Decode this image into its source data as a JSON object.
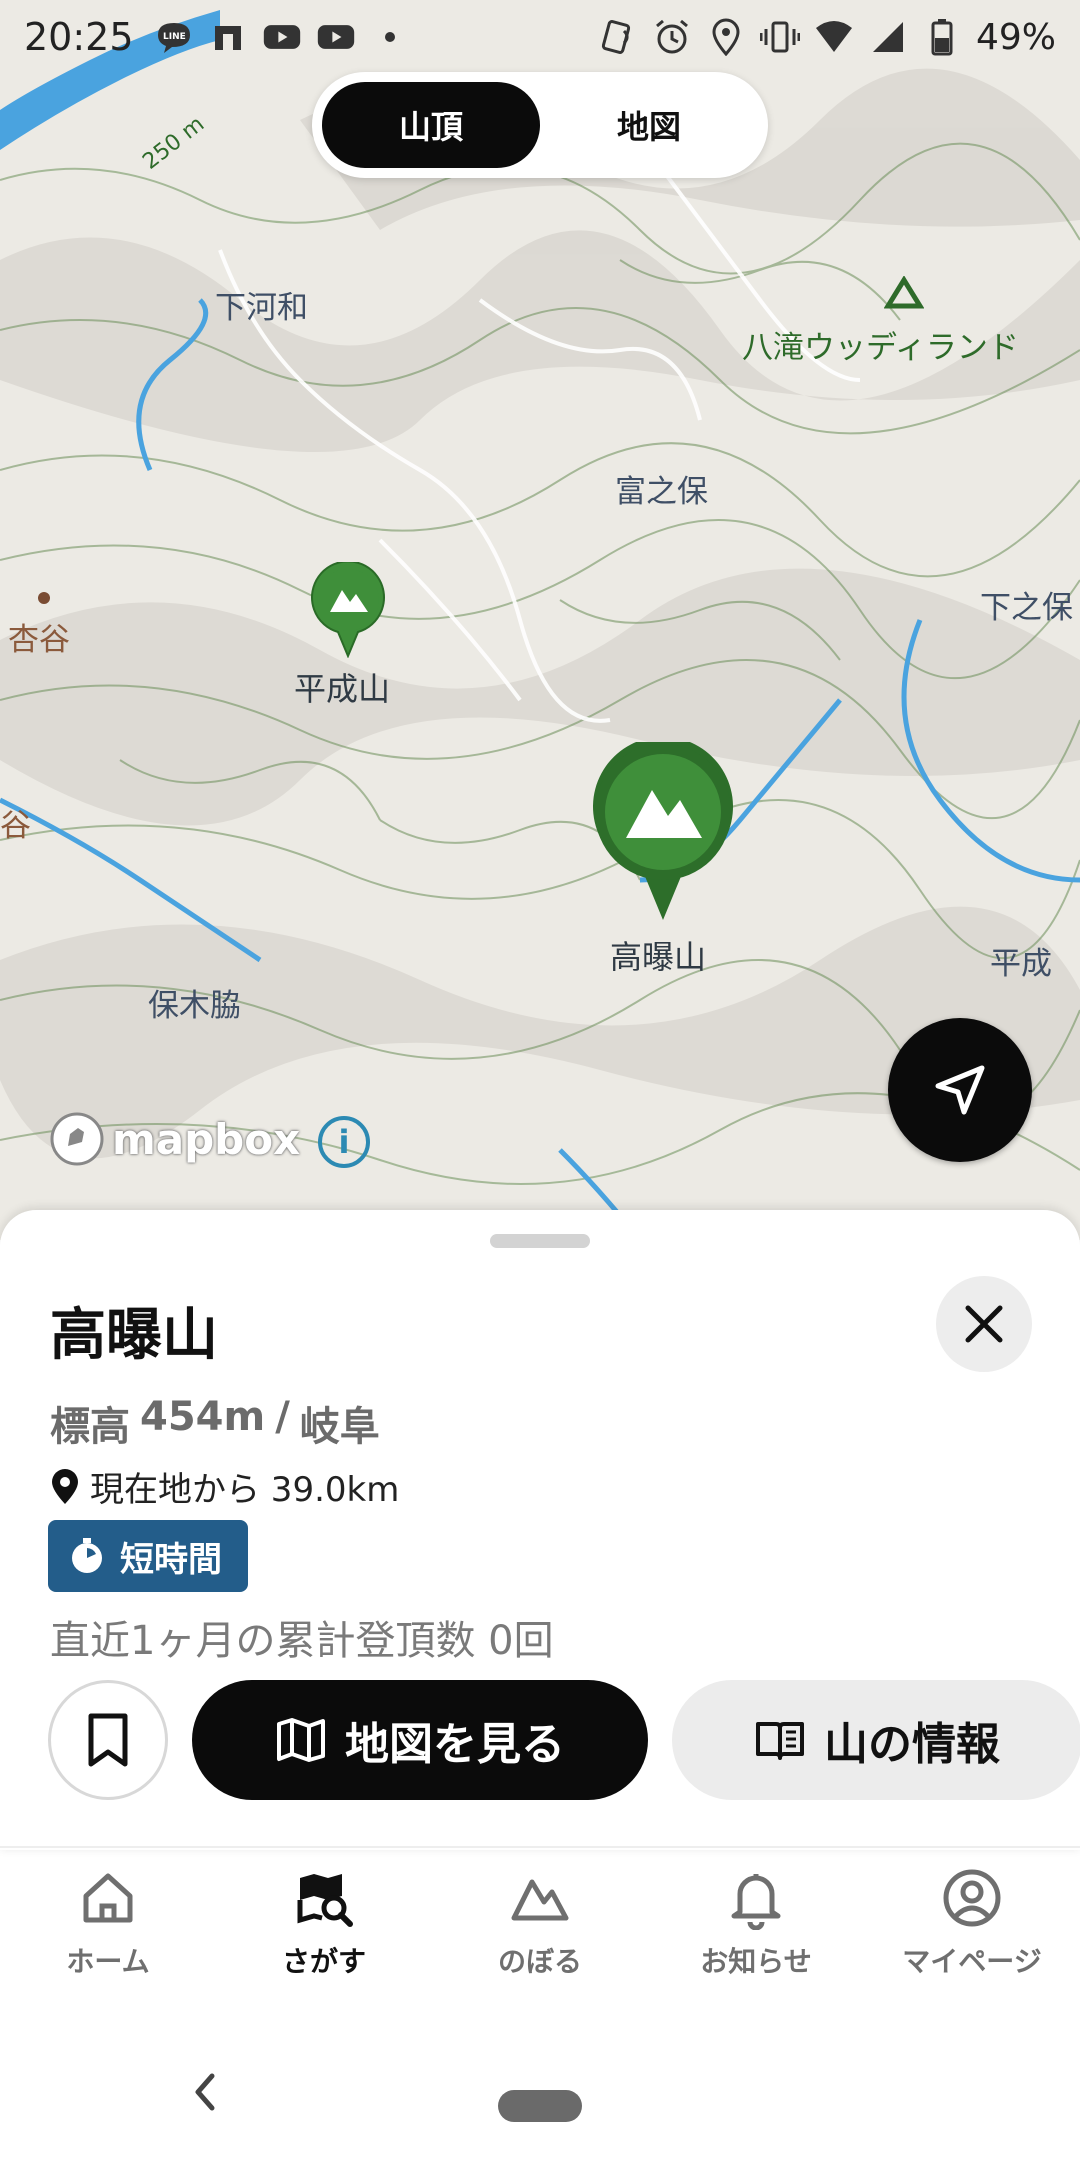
{
  "status_bar": {
    "time": "20:25",
    "battery": "49%",
    "left_icons": [
      "line-icon",
      "n-icon",
      "youtube-icon",
      "youtube-icon",
      "dot-icon"
    ],
    "right_icons": [
      "nfc-icon",
      "alarm-icon",
      "location-icon",
      "vibrate-icon",
      "wifi-icon",
      "signal-icon",
      "battery-icon"
    ]
  },
  "segment": {
    "options": [
      "山頂",
      "地図"
    ],
    "selected": "山頂"
  },
  "map": {
    "contour_label": "250 m",
    "place_labels": [
      "下河和",
      "八滝ウッディランド",
      "富之保",
      "下之保",
      "杏谷",
      "谷",
      "平成",
      "保木脇"
    ],
    "peaks": [
      {
        "name": "平成山",
        "selected": false
      },
      {
        "name": "高曝山",
        "selected": true
      }
    ],
    "attribution": "mapbox",
    "info_symbol": "i",
    "colors": {
      "land": "#eceae4",
      "water": "#4aa3df",
      "contour": "#6c8f5a",
      "pin": "#3f8f3a"
    }
  },
  "sheet": {
    "title": "高曝山",
    "elevation_label": "標高",
    "elevation": "454m",
    "separator": "/",
    "prefecture": "岐阜",
    "distance": "現在地から 39.0km",
    "badge": "短時間",
    "badge_color": "#235d8a",
    "summit_count": "直近1ヶ月の累計登頂数 0回",
    "map_button": "地図を見る",
    "info_button": "山の情報"
  },
  "nav": {
    "items": [
      {
        "label": "ホーム",
        "icon": "home-icon",
        "active": false
      },
      {
        "label": "さがす",
        "icon": "search-map-icon",
        "active": true
      },
      {
        "label": "のぼる",
        "icon": "mountain-icon",
        "active": false
      },
      {
        "label": "お知らせ",
        "icon": "bell-icon",
        "active": false
      },
      {
        "label": "マイページ",
        "icon": "user-icon",
        "active": false
      }
    ]
  }
}
